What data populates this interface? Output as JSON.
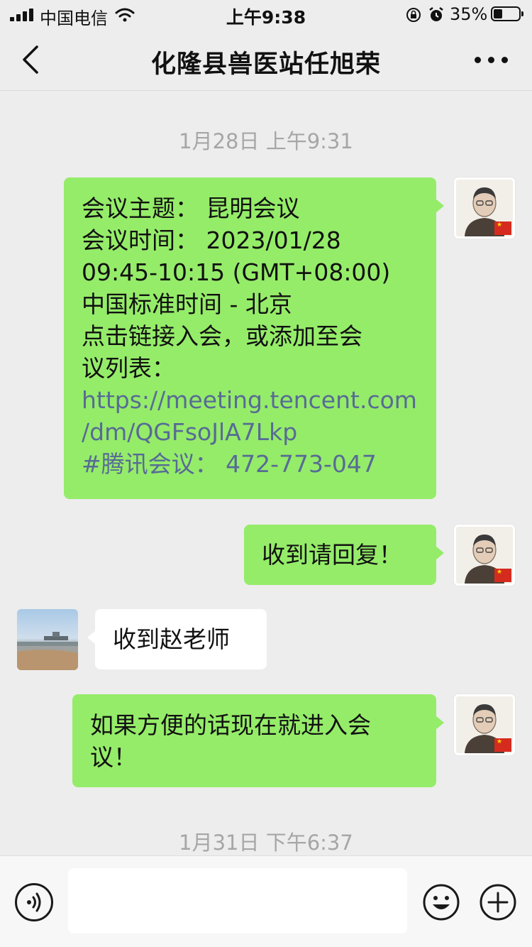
{
  "status_bar": {
    "carrier": "中国电信",
    "time": "上午9:38",
    "battery_percent": "35%",
    "battery_level": 0.35,
    "icons": [
      "signal-icon",
      "wifi-icon",
      "orientation-lock-icon",
      "alarm-icon",
      "battery-icon"
    ]
  },
  "header": {
    "title": "化隆县兽医站任旭荣",
    "back_icon": "chevron-left-icon",
    "more_icon": "more-dots-icon"
  },
  "messages": [
    {
      "type": "timestamp",
      "text": "1月28日 上午9:31"
    },
    {
      "type": "message",
      "side": "right",
      "sender": "me",
      "lines": [
        {
          "text": "会议主题：  昆明会议",
          "style": "text"
        },
        {
          "text": "会议时间：  2023/01/28",
          "style": "text"
        },
        {
          "text": "09:45-10:15 (GMT+08:00)",
          "style": "text"
        },
        {
          "text": "中国标准时间 - 北京",
          "style": "text"
        },
        {
          "text": "点击链接入会，或添加至会",
          "style": "text"
        },
        {
          "text": "议列表：",
          "style": "text"
        },
        {
          "text": "https://meeting.tencent.com",
          "style": "link"
        },
        {
          "text": "/dm/QGFsoJlA7Lkp",
          "style": "link"
        },
        {
          "text": "#腾讯会议：  472-773-047",
          "style": "link"
        }
      ]
    },
    {
      "type": "message",
      "side": "right",
      "sender": "me",
      "lines": [
        {
          "text": "收到请回复！",
          "style": "text"
        }
      ]
    },
    {
      "type": "message",
      "side": "left",
      "sender": "other",
      "lines": [
        {
          "text": "收到赵老师",
          "style": "text"
        }
      ]
    },
    {
      "type": "message",
      "side": "right",
      "sender": "me",
      "lines": [
        {
          "text": "如果方便的话现在就进入会",
          "style": "text"
        },
        {
          "text": "议！",
          "style": "text"
        }
      ]
    },
    {
      "type": "timestamp",
      "text": "1月31日 下午6:37"
    }
  ],
  "input_bar": {
    "voice_icon": "voice-icon",
    "input_value": "",
    "emoji_icon": "emoji-icon",
    "plus_icon": "plus-icon"
  },
  "colors": {
    "background": "#ededed",
    "bubble_me": "#95ec69",
    "bubble_other": "#ffffff",
    "link": "#576b95",
    "timestamp": "#a6a6a6"
  }
}
